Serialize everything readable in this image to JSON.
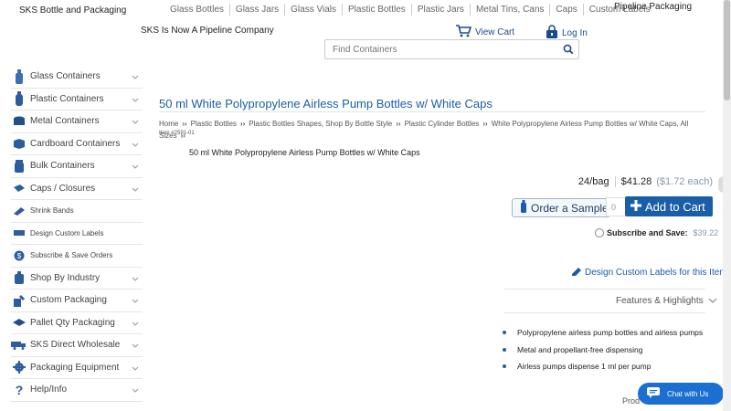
{
  "header": {
    "brand": "SKS Bottle and Packaging",
    "nav": [
      "Glass Bottles",
      "Glass Jars",
      "Glass Vials",
      "Plastic Bottles",
      "Plastic Jars",
      "Metal Tins, Cans",
      "Caps",
      "Custom Labels"
    ],
    "pipeline": "Pipeline Packaging",
    "tagline": "SKS Is Now A Pipeline Company",
    "view_cart": "View Cart",
    "log_in": "Log In",
    "search_placeholder": "Find Containers"
  },
  "sidebar": {
    "items": [
      {
        "label": "Glass Containers",
        "icon": "glass-bottle-icon"
      },
      {
        "label": "Plastic Containers",
        "icon": "plastic-bottle-icon"
      },
      {
        "label": "Metal Containers",
        "icon": "metal-tin-icon"
      },
      {
        "label": "Cardboard Containers",
        "icon": "box-icon"
      },
      {
        "label": "Bulk Containers",
        "icon": "bulk-jar-icon"
      },
      {
        "label": "Caps / Closures",
        "icon": "cap-icon"
      },
      {
        "label": "Shrink Bands",
        "icon": "shrink-band-icon"
      },
      {
        "label": "Design Custom Labels",
        "icon": "label-icon"
      },
      {
        "label": "Subscribe & Save Orders",
        "icon": "dollar-icon"
      },
      {
        "label": "Shop By Industry",
        "icon": "industry-icon"
      },
      {
        "label": "Custom Packaging",
        "icon": "custom-packaging-icon"
      },
      {
        "label": "Pallet Qty Packaging",
        "icon": "pallet-icon"
      },
      {
        "label": "SKS Direct Wholesale",
        "icon": "truck-icon"
      },
      {
        "label": "Packaging Equipment",
        "icon": "gear-icon"
      },
      {
        "label": "Help/Info",
        "icon": "question-icon"
      }
    ]
  },
  "product": {
    "title": "50 ml White Polypropylene Airless Pump Bottles w/ White Caps",
    "breadcrumbs": [
      "Home",
      "Plastic Bottles",
      "Plastic Bottles Shapes, Shop By Bottle Style",
      "Plastic Cylinder Bottles",
      "White Polypropylene Airless Pump Bottles w/ White Caps, All Sizes"
    ],
    "item_number": "Item #2591-01",
    "subtitle": "50 ml White Polypropylene Airless Pump Bottles w/ White Caps",
    "pack": "24/bag",
    "price": "$41.28",
    "price_each": "($1.72 each)",
    "order_sample": "Order a Sample",
    "qty_value": "0",
    "add_to_cart": "Add to Cart",
    "subscribe_label": "Subscribe and Save:",
    "subscribe_price": "$39.22",
    "design_labels": "Design Custom Labels for this Item",
    "features_heading": "Features & Highlights",
    "features": [
      "Polypropylene airless pump bottles and airless pumps",
      "Metal and propellant-free dispensing",
      "Airless pumps dispense 1 ml per pump"
    ],
    "partial_text": "Prod"
  },
  "chat": {
    "label": "Chat with Us"
  },
  "colors": {
    "accent": "#1a5ea8",
    "chat": "#1a6fd0"
  }
}
